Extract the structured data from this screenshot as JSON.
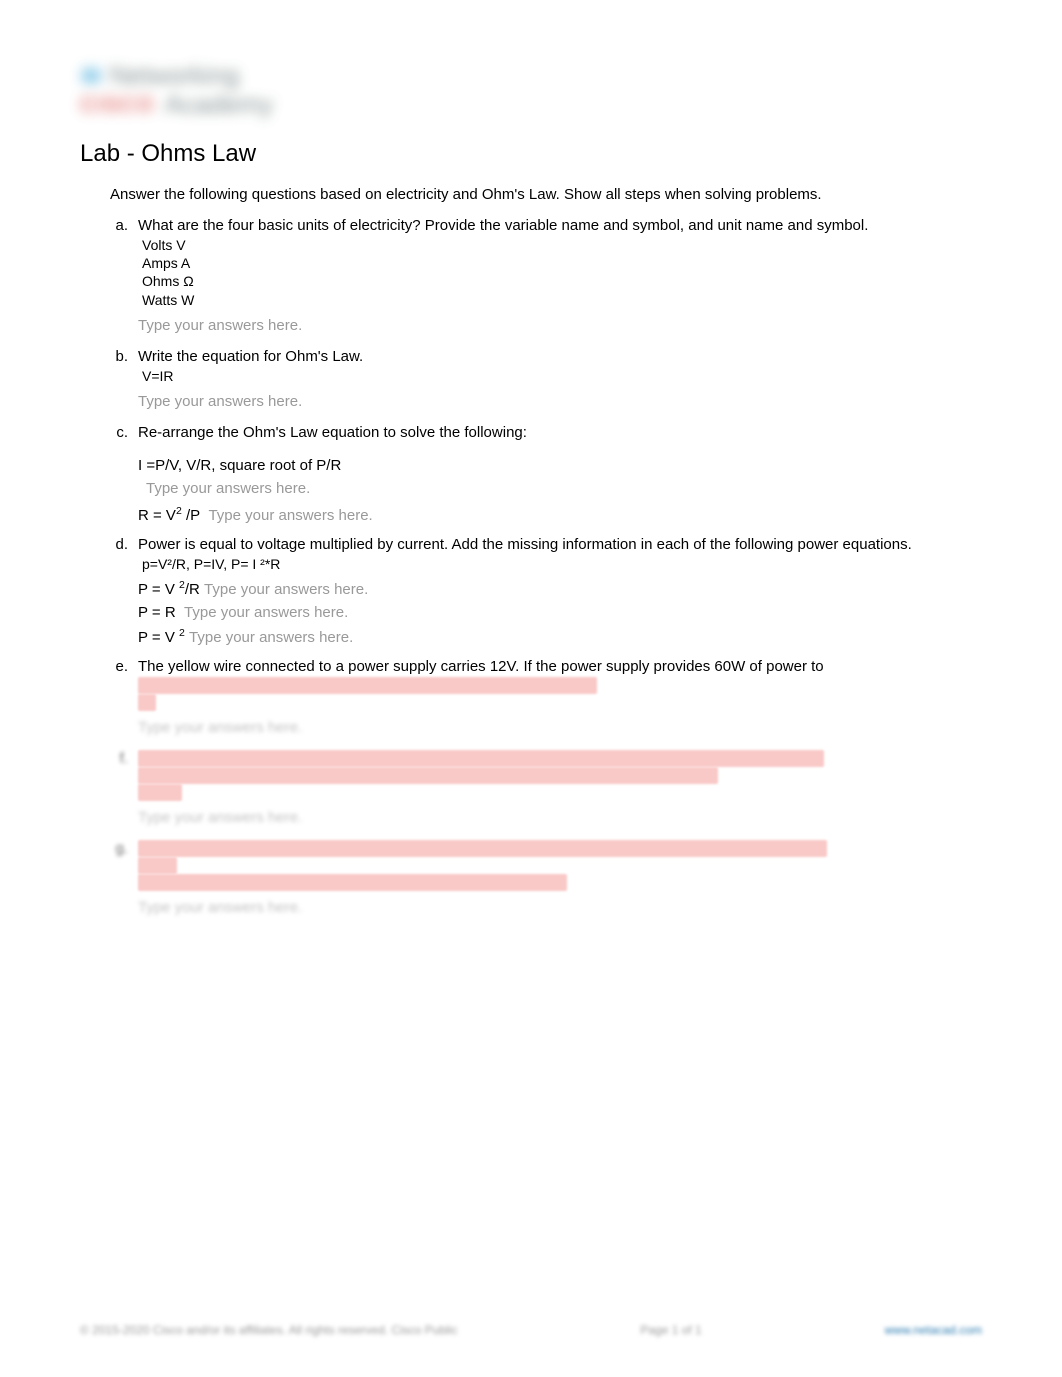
{
  "logo": {
    "brand_icon": "cisco-bars-icon",
    "word1": "Networking",
    "brand_word": "CISCO",
    "word2": "Academy"
  },
  "title": "Lab - Ohms Law",
  "intro": "Answer the following questions based on electricity and Ohm's Law. Show all steps when solving problems.",
  "placeholder_text": "Type your answers here.",
  "questions": {
    "a": {
      "letter": "a.",
      "text": "What are the four basic units of electricity? Provide the variable name and symbol, and unit name and symbol.",
      "answer_lines": [
        "Volts V",
        "Amps A",
        "Ohms Ω",
        "Watts W"
      ]
    },
    "b": {
      "letter": "b.",
      "text": "Write the equation for Ohm's Law.",
      "answer_lines": [
        "V=IR"
      ]
    },
    "c": {
      "letter": "c.",
      "text": "Re-arrange the Ohm's Law equation to solve the following:",
      "sub_i": "I =P/V, V/R, square root of P/R",
      "sub_r_prefix": "R = V",
      "sub_r_suffix": " /P"
    },
    "d": {
      "letter": "d.",
      "text": "Power is equal to voltage multiplied by current. Add the missing information in each of the following power equations.",
      "answer_top": "p=V²/R, P=IV, P= I ²*R",
      "line1_prefix": "P = V ",
      "line1_mid": "/R",
      "line2_prefix": "P = R",
      "line3_prefix": "P = V "
    },
    "e": {
      "letter": "e.",
      "text": "The yellow wire connected to a power supply carries 12V. If the power supply provides 60W of power to"
    },
    "f": {
      "letter": "f."
    },
    "g": {
      "letter": "g."
    }
  },
  "footer": {
    "left": "© 2015-2020 Cisco and/or its affiliates. All rights reserved. Cisco Public",
    "mid": "Page 1 of 1",
    "right": "www.netacad.com"
  }
}
